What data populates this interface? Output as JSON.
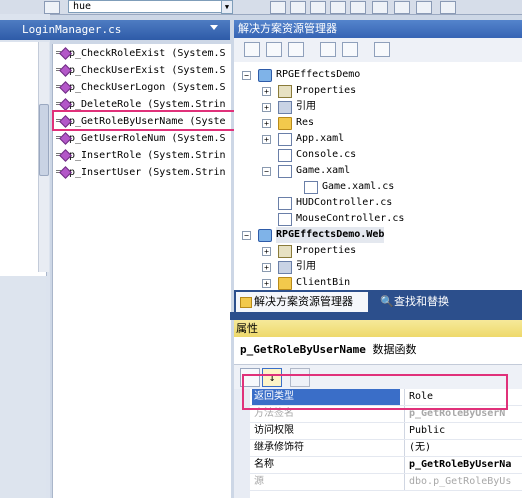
{
  "toolbar": {
    "find_value": "hue"
  },
  "editor": {
    "file_tab": "LoginManager.cs"
  },
  "members": [
    {
      "label": "p_CheckRoleExist (System.S"
    },
    {
      "label": "p_CheckUserExist (System.S"
    },
    {
      "label": "p_CheckUserLogon (System.S"
    },
    {
      "label": "p_DeleteRole (System.Strin"
    },
    {
      "label": "p_GetRoleByUserName (Syste"
    },
    {
      "label": "p_GetUserRoleNum (System.S"
    },
    {
      "label": "p_InsertRole (System.Strin"
    },
    {
      "label": "p_InsertUser (System.Strin"
    }
  ],
  "solution_explorer": {
    "title": "解决方案资源管理器",
    "items": [
      {
        "label": "RPGEffectsDemo"
      },
      {
        "label": "Properties"
      },
      {
        "label": "引用"
      },
      {
        "label": "Res"
      },
      {
        "label": "App.xaml"
      },
      {
        "label": "Console.cs"
      },
      {
        "label": "Game.xaml"
      },
      {
        "label": "Game.xaml.cs"
      },
      {
        "label": "HUDController.cs"
      },
      {
        "label": "MouseController.cs"
      },
      {
        "label": "RPGEffectsDemo.Web"
      },
      {
        "label": "Properties"
      },
      {
        "label": "引用"
      },
      {
        "label": "ClientBin"
      }
    ],
    "tabs": {
      "explorer": "解决方案资源管理器",
      "find_replace": "查找和替换"
    }
  },
  "properties": {
    "title": "属性",
    "object_name": "p_GetRoleByUserName",
    "object_type": "数据函数",
    "rows": [
      {
        "name": "返回类型",
        "value": "Role"
      },
      {
        "name": "方法签名",
        "value": "p_GetRoleByUserN"
      },
      {
        "name": "访问权限",
        "value": "Public"
      },
      {
        "name": "继承修饰符",
        "value": "(无)"
      },
      {
        "name": "名称",
        "value": "p_GetRoleByUserNa"
      },
      {
        "name": "源",
        "value": "dbo.p_GetRoleByUs"
      }
    ]
  },
  "colors": {
    "highlight_border": "#e0317a",
    "selection": "#3a6ec8",
    "title_bar": "#3664b4",
    "properties_title": "#eed96b"
  }
}
